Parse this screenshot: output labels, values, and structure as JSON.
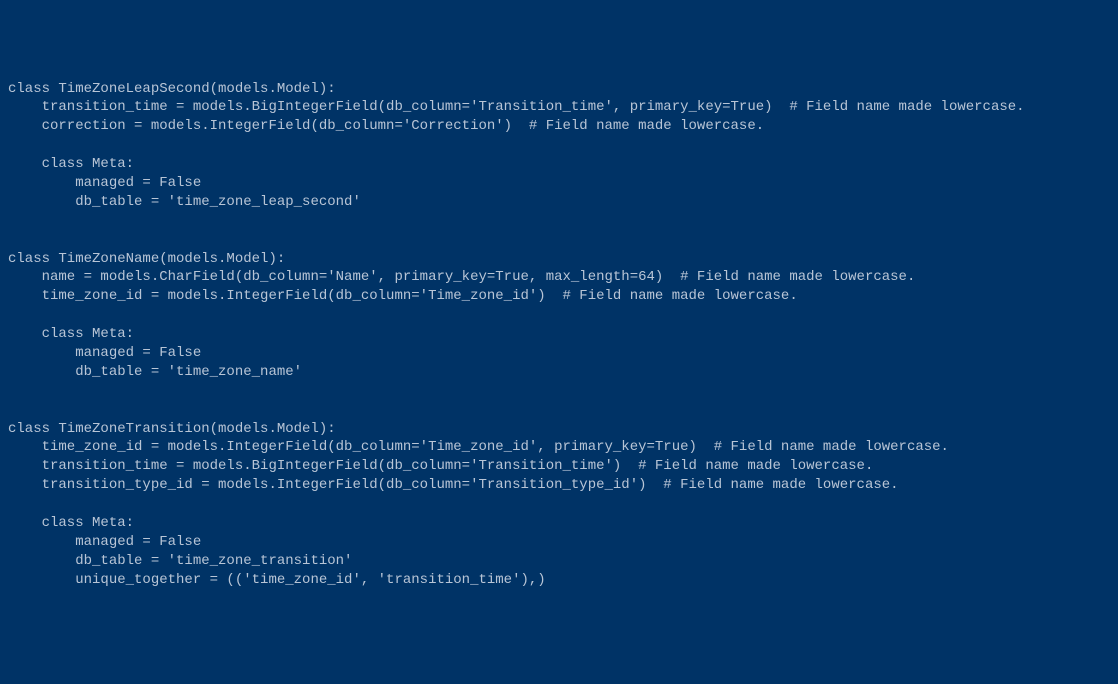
{
  "lines": [
    "class TimeZoneLeapSecond(models.Model):",
    "    transition_time = models.BigIntegerField(db_column='Transition_time', primary_key=True)  # Field name made lowercase.",
    "    correction = models.IntegerField(db_column='Correction')  # Field name made lowercase.",
    "",
    "    class Meta:",
    "        managed = False",
    "        db_table = 'time_zone_leap_second'",
    "",
    "",
    "class TimeZoneName(models.Model):",
    "    name = models.CharField(db_column='Name', primary_key=True, max_length=64)  # Field name made lowercase.",
    "    time_zone_id = models.IntegerField(db_column='Time_zone_id')  # Field name made lowercase.",
    "",
    "    class Meta:",
    "        managed = False",
    "        db_table = 'time_zone_name'",
    "",
    "",
    "class TimeZoneTransition(models.Model):",
    "    time_zone_id = models.IntegerField(db_column='Time_zone_id', primary_key=True)  # Field name made lowercase.",
    "    transition_time = models.BigIntegerField(db_column='Transition_time')  # Field name made lowercase.",
    "    transition_type_id = models.IntegerField(db_column='Transition_type_id')  # Field name made lowercase.",
    "",
    "    class Meta:",
    "        managed = False",
    "        db_table = 'time_zone_transition'",
    "        unique_together = (('time_zone_id', 'transition_time'),)"
  ]
}
